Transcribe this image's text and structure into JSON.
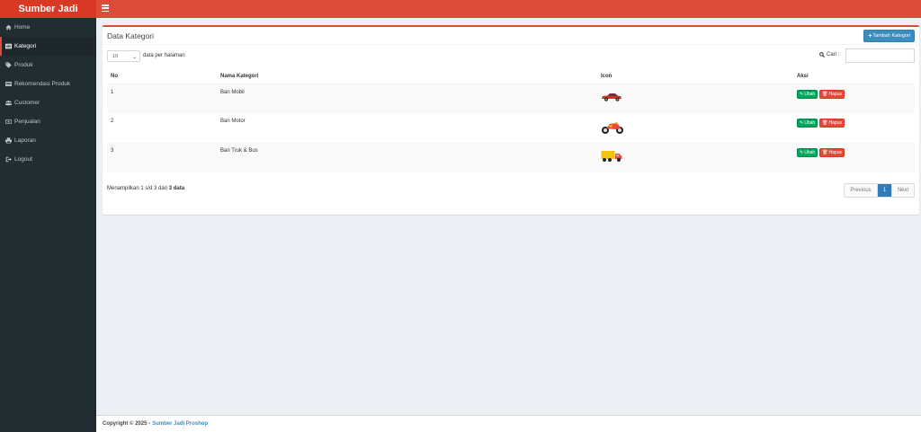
{
  "brand": "Sumber Jadi",
  "sidebar": {
    "items": [
      {
        "label": "Home",
        "icon": "home-icon"
      },
      {
        "label": "Kategori",
        "icon": "list-icon",
        "active": true
      },
      {
        "label": "Produk",
        "icon": "tag-icon"
      },
      {
        "label": "Rekomendasi Produk",
        "icon": "card-icon"
      },
      {
        "label": "Customer",
        "icon": "users-icon"
      },
      {
        "label": "Penjualan",
        "icon": "money-icon"
      },
      {
        "label": "Laporan",
        "icon": "print-icon"
      },
      {
        "label": "Logout",
        "icon": "signout-icon"
      }
    ]
  },
  "main": {
    "title": "Data Kategori",
    "add_button": "Tambah Kategori",
    "page_length": "10",
    "page_length_label": "data per halaman",
    "search_label": "Cari :",
    "search_value": "",
    "columns": [
      "No",
      "Nama Kategori",
      "Icon",
      "Aksi"
    ],
    "rows": [
      {
        "no": "1",
        "name": "Ban Mobil",
        "icon": "car-icon"
      },
      {
        "no": "2",
        "name": "Ban Motor",
        "icon": "motorcycle-icon"
      },
      {
        "no": "3",
        "name": "Ban Truk & Bus",
        "icon": "truck-icon"
      }
    ],
    "edit_label": "Ubah",
    "delete_label": "Hapus",
    "info_prefix": "Menampilkan 1 s/d 3 dari",
    "info_total": "3 data",
    "pager": {
      "prev": "Previous",
      "page": "1",
      "next": "Next"
    }
  },
  "footer": {
    "copyright": "Copyright © 2025 -",
    "link": "Sumber Jadi Proshop"
  },
  "colors": {
    "header": "#dd4b39",
    "logo": "#d73925",
    "sidebar": "#222d32",
    "primary": "#3c8dbc",
    "success": "#00a65a",
    "danger": "#dd4b39"
  }
}
